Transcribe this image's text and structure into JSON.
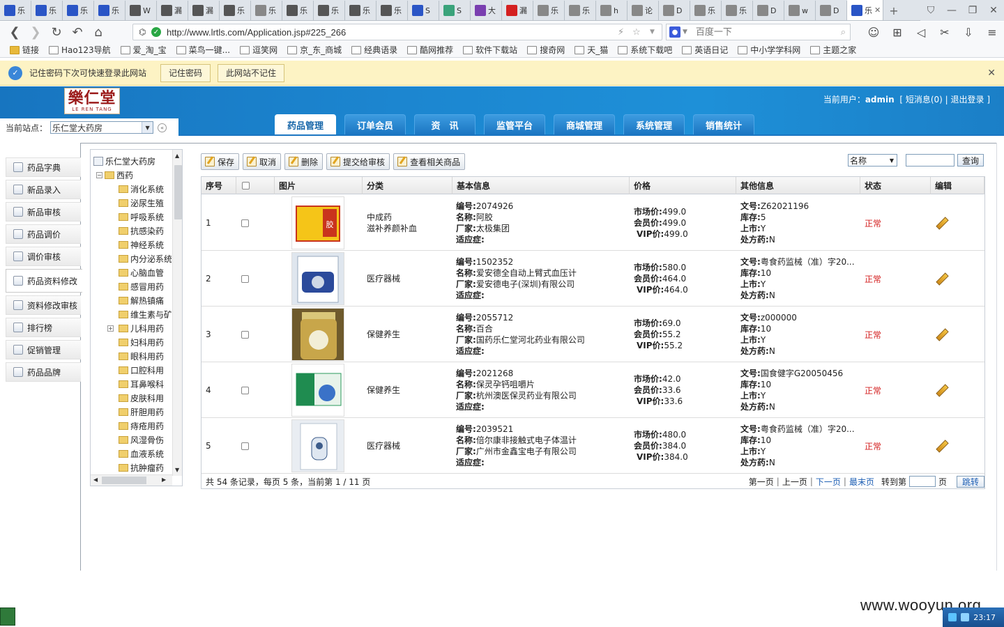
{
  "browser": {
    "tabs": [
      {
        "label": "乐",
        "color": "#2a55c6"
      },
      {
        "label": "乐",
        "color": "#2a55c6"
      },
      {
        "label": "乐",
        "color": "#2a55c6"
      },
      {
        "label": "乐",
        "color": "#2a55c6"
      },
      {
        "label": "W",
        "color": "#555555"
      },
      {
        "label": "漏",
        "color": "#555555"
      },
      {
        "label": "漏",
        "color": "#555555"
      },
      {
        "label": "乐",
        "color": "#555555"
      },
      {
        "label": "乐",
        "color": "#888888"
      },
      {
        "label": "乐",
        "color": "#555555"
      },
      {
        "label": "乐",
        "color": "#555555"
      },
      {
        "label": "乐",
        "color": "#555555"
      },
      {
        "label": "乐",
        "color": "#555555"
      },
      {
        "label": "S",
        "color": "#2a55c6"
      },
      {
        "label": "S",
        "color": "#3aa37b"
      },
      {
        "label": "大",
        "color": "#7a3fb0"
      },
      {
        "label": "漏",
        "color": "#d42020"
      },
      {
        "label": "乐",
        "color": "#888888"
      },
      {
        "label": "乐",
        "color": "#888888"
      },
      {
        "label": "h",
        "color": "#888888"
      },
      {
        "label": "论",
        "color": "#888888"
      },
      {
        "label": "D",
        "color": "#888888"
      },
      {
        "label": "乐",
        "color": "#888888"
      },
      {
        "label": "乐",
        "color": "#888888"
      },
      {
        "label": "D",
        "color": "#888888"
      },
      {
        "label": "w",
        "color": "#888888"
      },
      {
        "label": "D",
        "color": "#888888"
      }
    ],
    "active_tab": {
      "label": "乐",
      "close": "✕"
    },
    "new_tab_icon": "plus-icon",
    "window_controls": [
      "shirt-icon",
      "minimize-icon",
      "restore-icon",
      "close-icon"
    ],
    "url": "http://www.lrtls.com/Application.jsp#225_266",
    "search_placeholder": "百度一下",
    "tool_icons": [
      "chat-icon",
      "apps-icon",
      "speaker-icon",
      "scissors-icon",
      "download-icon",
      "menu-icon"
    ]
  },
  "bookmarks": [
    {
      "label": "链接",
      "folder": true
    },
    {
      "label": "Hao123导航",
      "folder": false
    },
    {
      "label": "爱_淘_宝",
      "folder": false
    },
    {
      "label": "菜鸟一键...",
      "folder": false
    },
    {
      "label": "逗笑网",
      "folder": false
    },
    {
      "label": "京_东_商城",
      "folder": false
    },
    {
      "label": "经典语录",
      "folder": false
    },
    {
      "label": "酷网推荐",
      "folder": false
    },
    {
      "label": "软件下载站",
      "folder": false
    },
    {
      "label": "搜奇网",
      "folder": false
    },
    {
      "label": "天_猫",
      "folder": false
    },
    {
      "label": "系统下载吧",
      "folder": false
    },
    {
      "label": "英语日记",
      "folder": false
    },
    {
      "label": "中小学学科网",
      "folder": false
    },
    {
      "label": "主题之家",
      "folder": false
    }
  ],
  "password_bar": {
    "text": "记住密码下次可快速登录此网站",
    "remember": "记住密码",
    "never": "此网站不记住"
  },
  "site": {
    "logo_cn": "樂仁堂",
    "logo_en": "LE REN TANG",
    "user_label": "当前用户：",
    "user_name": "admin",
    "messages_link": "短消息(0)",
    "logout_link": "退出登录",
    "station_label": "当前站点：",
    "station_value": "乐仁堂大药房"
  },
  "nav_tabs": [
    "药品管理",
    "订单会员",
    "资　讯",
    "监管平台",
    "商城管理",
    "系统管理",
    "销售统计"
  ],
  "left_menu": [
    "药品字典",
    "新品录入",
    "新品审核",
    "药品调价",
    "调价审核",
    "药品资料修改",
    "资料修改审核",
    "排行榜",
    "促销管理",
    "药品品牌"
  ],
  "tree": {
    "root": "乐仁堂大药房",
    "group": "西药",
    "items": [
      "消化系统",
      "泌尿生殖",
      "呼吸系统",
      "抗感染药",
      "神经系统",
      "内分泌系统",
      "心脑血管",
      "感冒用药",
      "解热镇痛",
      "维生素与矿",
      "儿科用药",
      "妇科用药",
      "眼科用药",
      "口腔科用",
      "耳鼻喉科",
      "皮肤科用",
      "肝胆用药",
      "痔疮用药",
      "风湿骨伤",
      "血液系统",
      "抗肿瘤药"
    ]
  },
  "actions": [
    "保存",
    "取消",
    "删除",
    "提交给审核",
    "查看相关商品"
  ],
  "query": {
    "field": "名称",
    "button": "查询"
  },
  "columns": [
    "序号",
    "",
    "图片",
    "分类",
    "基本信息",
    "价格",
    "其他信息",
    "状态",
    "编辑"
  ],
  "labels": {
    "code": "编号:",
    "name": "名称:",
    "maker": "厂家:",
    "indication": "适应症:",
    "market": "市场价:",
    "member": "会员价:",
    "vip": "VIP价:",
    "doc": "文号:",
    "stock": "库存:",
    "listed": "上市:",
    "rx": "处方药:"
  },
  "rows": [
    {
      "no": "1",
      "category": "中成药\n滋补养颜补血",
      "category1": "中成药",
      "category2": "滋补养颜补血",
      "code": "2074926",
      "name": "阿胶",
      "maker": "太极集团",
      "indication": "",
      "market": "499.0",
      "member": "499.0",
      "vip": "499.0",
      "doc": "Z62021196",
      "stock": "5",
      "listed": "Y",
      "rx": "N",
      "status": "正常",
      "img": "阿胶"
    },
    {
      "no": "2",
      "category1": "医疗器械",
      "category2": "",
      "code": "1502352",
      "name": "爱安德全自动上臂式血压计",
      "maker": "爱安德电子(深圳)有限公司",
      "indication": "",
      "market": "580.0",
      "member": "464.0",
      "vip": "464.0",
      "doc": "粤食药监械（准）字20...",
      "stock": "10",
      "listed": "Y",
      "rx": "N",
      "status": "正常",
      "img": ""
    },
    {
      "no": "3",
      "category1": "保健养生",
      "category2": "",
      "code": "2055712",
      "name": "百合",
      "maker": "国药乐仁堂河北药业有限公司",
      "indication": "",
      "market": "69.0",
      "member": "55.2",
      "vip": "55.2",
      "doc": "z000000",
      "stock": "10",
      "listed": "Y",
      "rx": "N",
      "status": "正常",
      "img": "百合"
    },
    {
      "no": "4",
      "category1": "保健养生",
      "category2": "",
      "code": "2021268",
      "name": "保灵孕钙咀嚼片",
      "maker": "杭州澳医保灵药业有限公司",
      "indication": "",
      "market": "42.0",
      "member": "33.6",
      "vip": "33.6",
      "doc": "国食健字G20050456",
      "stock": "10",
      "listed": "Y",
      "rx": "N",
      "status": "正常",
      "img": ""
    },
    {
      "no": "5",
      "category1": "医疗器械",
      "category2": "",
      "code": "2039521",
      "name": "倍尔康非接触式电子体温计",
      "maker": "广州市金鑫宝电子有限公司",
      "indication": "",
      "market": "480.0",
      "member": "384.0",
      "vip": "384.0",
      "doc": "粤食药监械（准）字20...",
      "stock": "10",
      "listed": "Y",
      "rx": "N",
      "status": "正常",
      "img": ""
    }
  ],
  "pager": {
    "summary": "共 54 条记录，每页 5 条，当前第 1 / 11 页",
    "first": "第一页",
    "prev": "上一页",
    "next": "下一页",
    "last": "最末页",
    "goto": "转到第",
    "page_unit": "页",
    "jump": "跳转"
  },
  "taskbar": {
    "clock": "23:17"
  },
  "watermark": "www.wooyun.org"
}
